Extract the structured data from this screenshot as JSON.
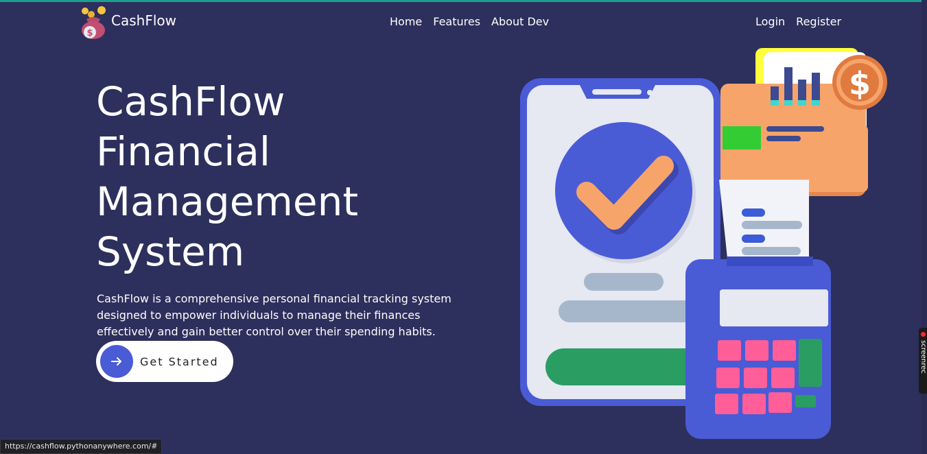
{
  "brand": {
    "name": "CashFlow"
  },
  "nav": {
    "home": "Home",
    "features": "Features",
    "about": "About Dev",
    "login": "Login",
    "register": "Register"
  },
  "hero": {
    "title_lines": [
      "CashFlow",
      "Financial",
      "Management",
      "System"
    ],
    "description": "CashFlow is a comprehensive personal financial tracking system designed to empower individuals to manage their finances effectively and gain better control over their spending habits.",
    "cta_label": "Get Started"
  },
  "status_bar": {
    "url": "https://cashflow.pythonanywhere.com/#"
  },
  "side_tab": {
    "label": "screenrec"
  },
  "colors": {
    "background": "#2d2f5c",
    "accent": "#4a5bd6",
    "orange": "#f7a46a",
    "pink": "#ff5e98",
    "green": "#2a9d63"
  }
}
